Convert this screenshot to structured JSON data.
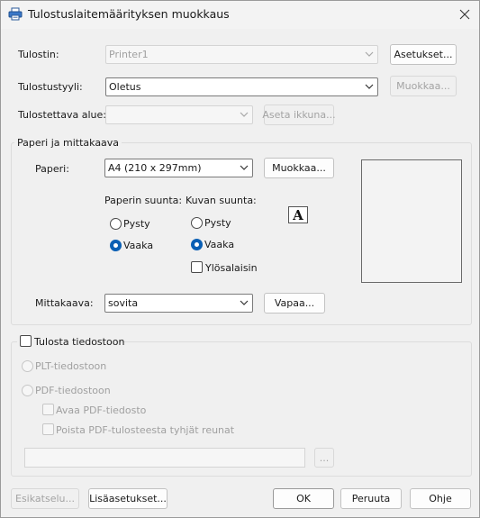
{
  "window": {
    "title": "Tulostuslaitemäärityksen muokkaus",
    "app_icon": "printer-icon",
    "close_icon": "close-icon"
  },
  "printer": {
    "label": "Tulostin:",
    "value": "Printer1",
    "settings_button": "Asetukset..."
  },
  "style": {
    "label": "Tulostustyyli:",
    "value": "Oletus",
    "edit_button": "Muokkaa..."
  },
  "area": {
    "label": "Tulostettava alue:",
    "value": "",
    "window_button": "Aseta ikkuna..."
  },
  "paper_group": {
    "title": "Paperi ja mittakaava",
    "paper_label": "Paperi:",
    "paper_value": "A4 (210 x 297mm)",
    "paper_edit_button": "Muokkaa...",
    "paper_orientation": {
      "title": "Paperin suunta:",
      "options": [
        "Pysty",
        "Vaaka"
      ],
      "selected": "Vaaka"
    },
    "image_orientation": {
      "title": "Kuvan suunta:",
      "options": [
        "Pysty",
        "Vaaka"
      ],
      "selected": "Vaaka",
      "upside_down_label": "Ylösalaisin",
      "upside_down_checked": false
    },
    "orientation_icon": "letter-a-icon",
    "orientation_glyph": "A",
    "scale_label": "Mittakaava:",
    "scale_value": "sovita",
    "free_button": "Vapaa..."
  },
  "file_group": {
    "checkbox_label": "Tulosta tiedostoon",
    "checked": false,
    "plt_label": "PLT-tiedostoon",
    "pdf_label": "PDF-tiedostoon",
    "open_pdf_label": "Avaa PDF-tiedosto",
    "trim_pdf_label": "Poista PDF-tulosteesta tyhjät reunat",
    "file_path": "",
    "browse_button": "..."
  },
  "footer": {
    "preview_button": "Esikatselu...",
    "more_button": "Lisäasetukset...",
    "ok_button": "OK",
    "cancel_button": "Peruuta",
    "help_button": "Ohje"
  }
}
